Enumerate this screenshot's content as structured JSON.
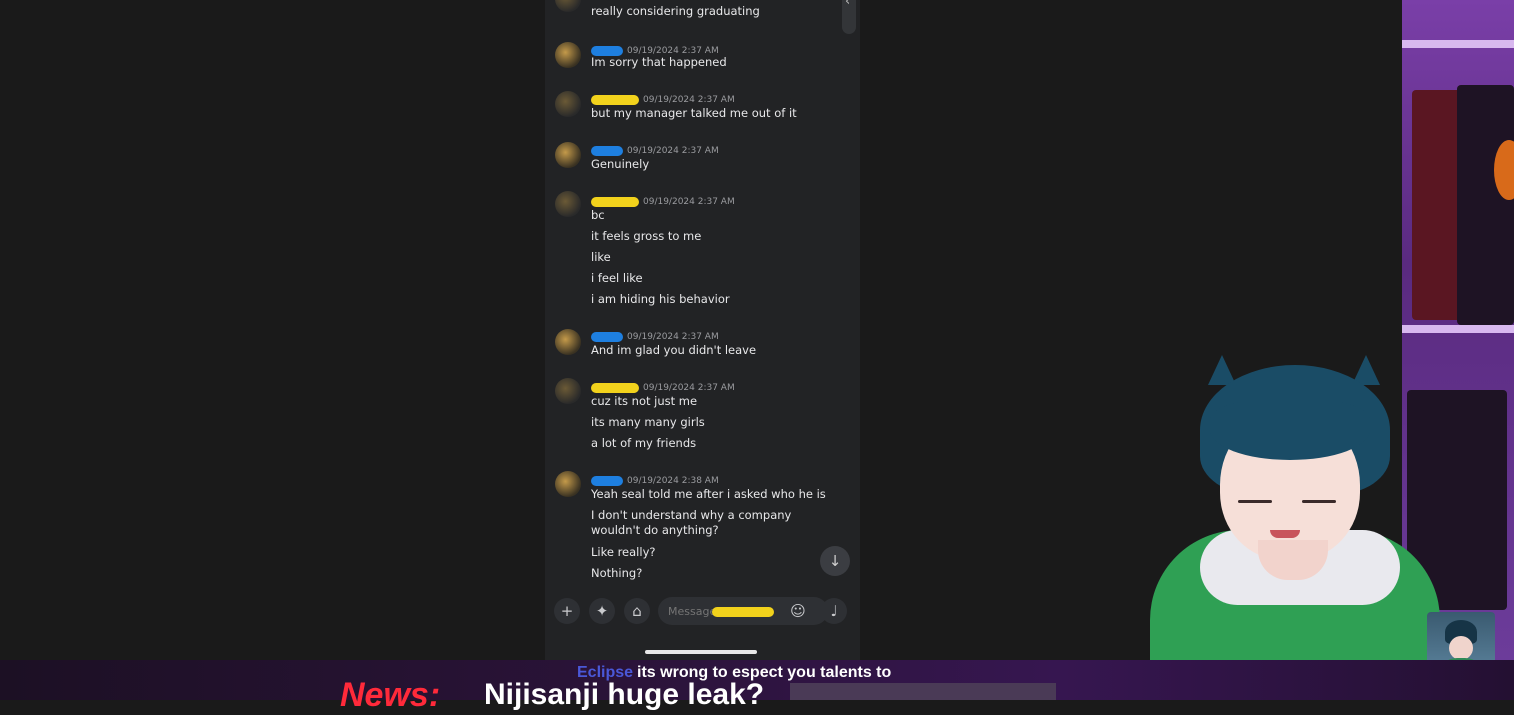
{
  "chat": {
    "messages": [
      {
        "timestamp": "",
        "lines": [
          "really considering graduating"
        ]
      },
      {
        "timestamp": "09/19/2024 2:37 AM",
        "lines": [
          "Im sorry that happened"
        ]
      },
      {
        "timestamp": "09/19/2024 2:37 AM",
        "lines": [
          "but my manager talked me out of it"
        ]
      },
      {
        "timestamp": "09/19/2024 2:37 AM",
        "lines": [
          "Genuinely"
        ]
      },
      {
        "timestamp": "09/19/2024 2:37 AM",
        "lines": [
          "bc",
          "it feels gross to me",
          "like",
          "i feel like",
          "i am hiding his behavior"
        ]
      },
      {
        "timestamp": "09/19/2024 2:37 AM",
        "lines": [
          "And im glad you didn't leave"
        ]
      },
      {
        "timestamp": "09/19/2024 2:37 AM",
        "lines": [
          "cuz its not just me",
          "its many many girls",
          "a lot of my friends"
        ]
      },
      {
        "timestamp": "09/19/2024 2:38 AM",
        "lines": [
          "Yeah seal told me after i asked who he is",
          "I don't understand why a company wouldn't do anything?",
          "Like really?",
          "Nothing?"
        ]
      }
    ]
  },
  "composer": {
    "placeholder": "Message",
    "plus_icon": "+",
    "apps_icon": "✦",
    "gift_icon": "⌂",
    "emoji_icon": "☺",
    "mic_icon": "♩"
  },
  "jump_icon": "↓",
  "scroll_icon": "‹",
  "stream": {
    "chat_user": "Eclipse",
    "chat_text": "its wrong to espect you talents to",
    "news_label": "News:",
    "news_text": "Nijisanji huge leak?"
  },
  "colors": {
    "redact_blue": "#1e7fe0",
    "redact_yellow": "#f2d21c",
    "news_red": "#ff2a3a"
  }
}
